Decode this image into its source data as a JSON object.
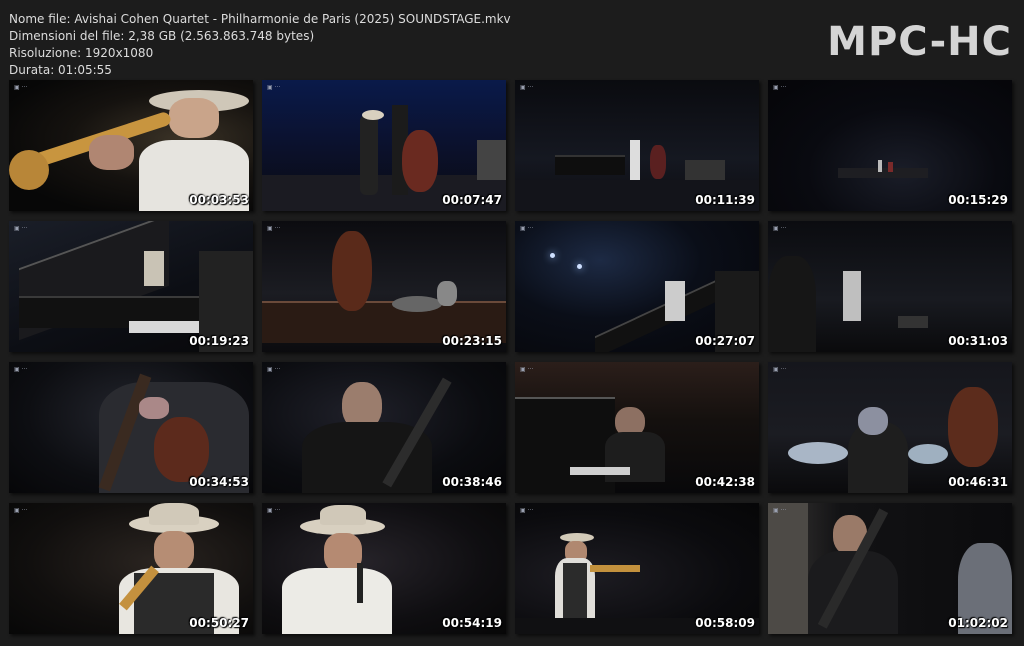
{
  "file_info": {
    "name": "Nome file: Avishai Cohen Quartet - Philharmonie de Paris (2025) SOUNDSTAGE.mkv",
    "size": "Dimensioni del file: 2,38 GB (2.563.863.748 bytes)",
    "resolution": "Risoluzione: 1920x1080",
    "duration": "Durata: 01:05:55"
  },
  "logo": "MPC-HC",
  "thumbnails": [
    {
      "timestamp": "00:03:53",
      "scene": "trumpet-closeup"
    },
    {
      "timestamp": "00:07:47",
      "scene": "stage-bass-trumpet"
    },
    {
      "timestamp": "00:11:39",
      "scene": "wide-stage-quartet"
    },
    {
      "timestamp": "00:15:29",
      "scene": "wide-dark-stage"
    },
    {
      "timestamp": "00:19:23",
      "scene": "piano-foreground"
    },
    {
      "timestamp": "00:23:15",
      "scene": "bass-and-drums"
    },
    {
      "timestamp": "00:27:07",
      "scene": "piano-lights"
    },
    {
      "timestamp": "00:31:03",
      "scene": "audience-view"
    },
    {
      "timestamp": "00:34:53",
      "scene": "bassist-closeup"
    },
    {
      "timestamp": "00:38:46",
      "scene": "pianist-closeup"
    },
    {
      "timestamp": "00:42:38",
      "scene": "pianist-playing"
    },
    {
      "timestamp": "00:46:31",
      "scene": "drummer-and-bass"
    },
    {
      "timestamp": "00:50:27",
      "scene": "trumpeter-hat"
    },
    {
      "timestamp": "00:54:19",
      "scene": "trumpeter-mic"
    },
    {
      "timestamp": "00:58:09",
      "scene": "trumpeter-full"
    },
    {
      "timestamp": "01:02:02",
      "scene": "pianist-side"
    }
  ],
  "colors": {
    "background": "#1c1c1c",
    "text": "#dcdcdc",
    "logo": "#d4d4d4",
    "timestamp": "#ffffff"
  }
}
